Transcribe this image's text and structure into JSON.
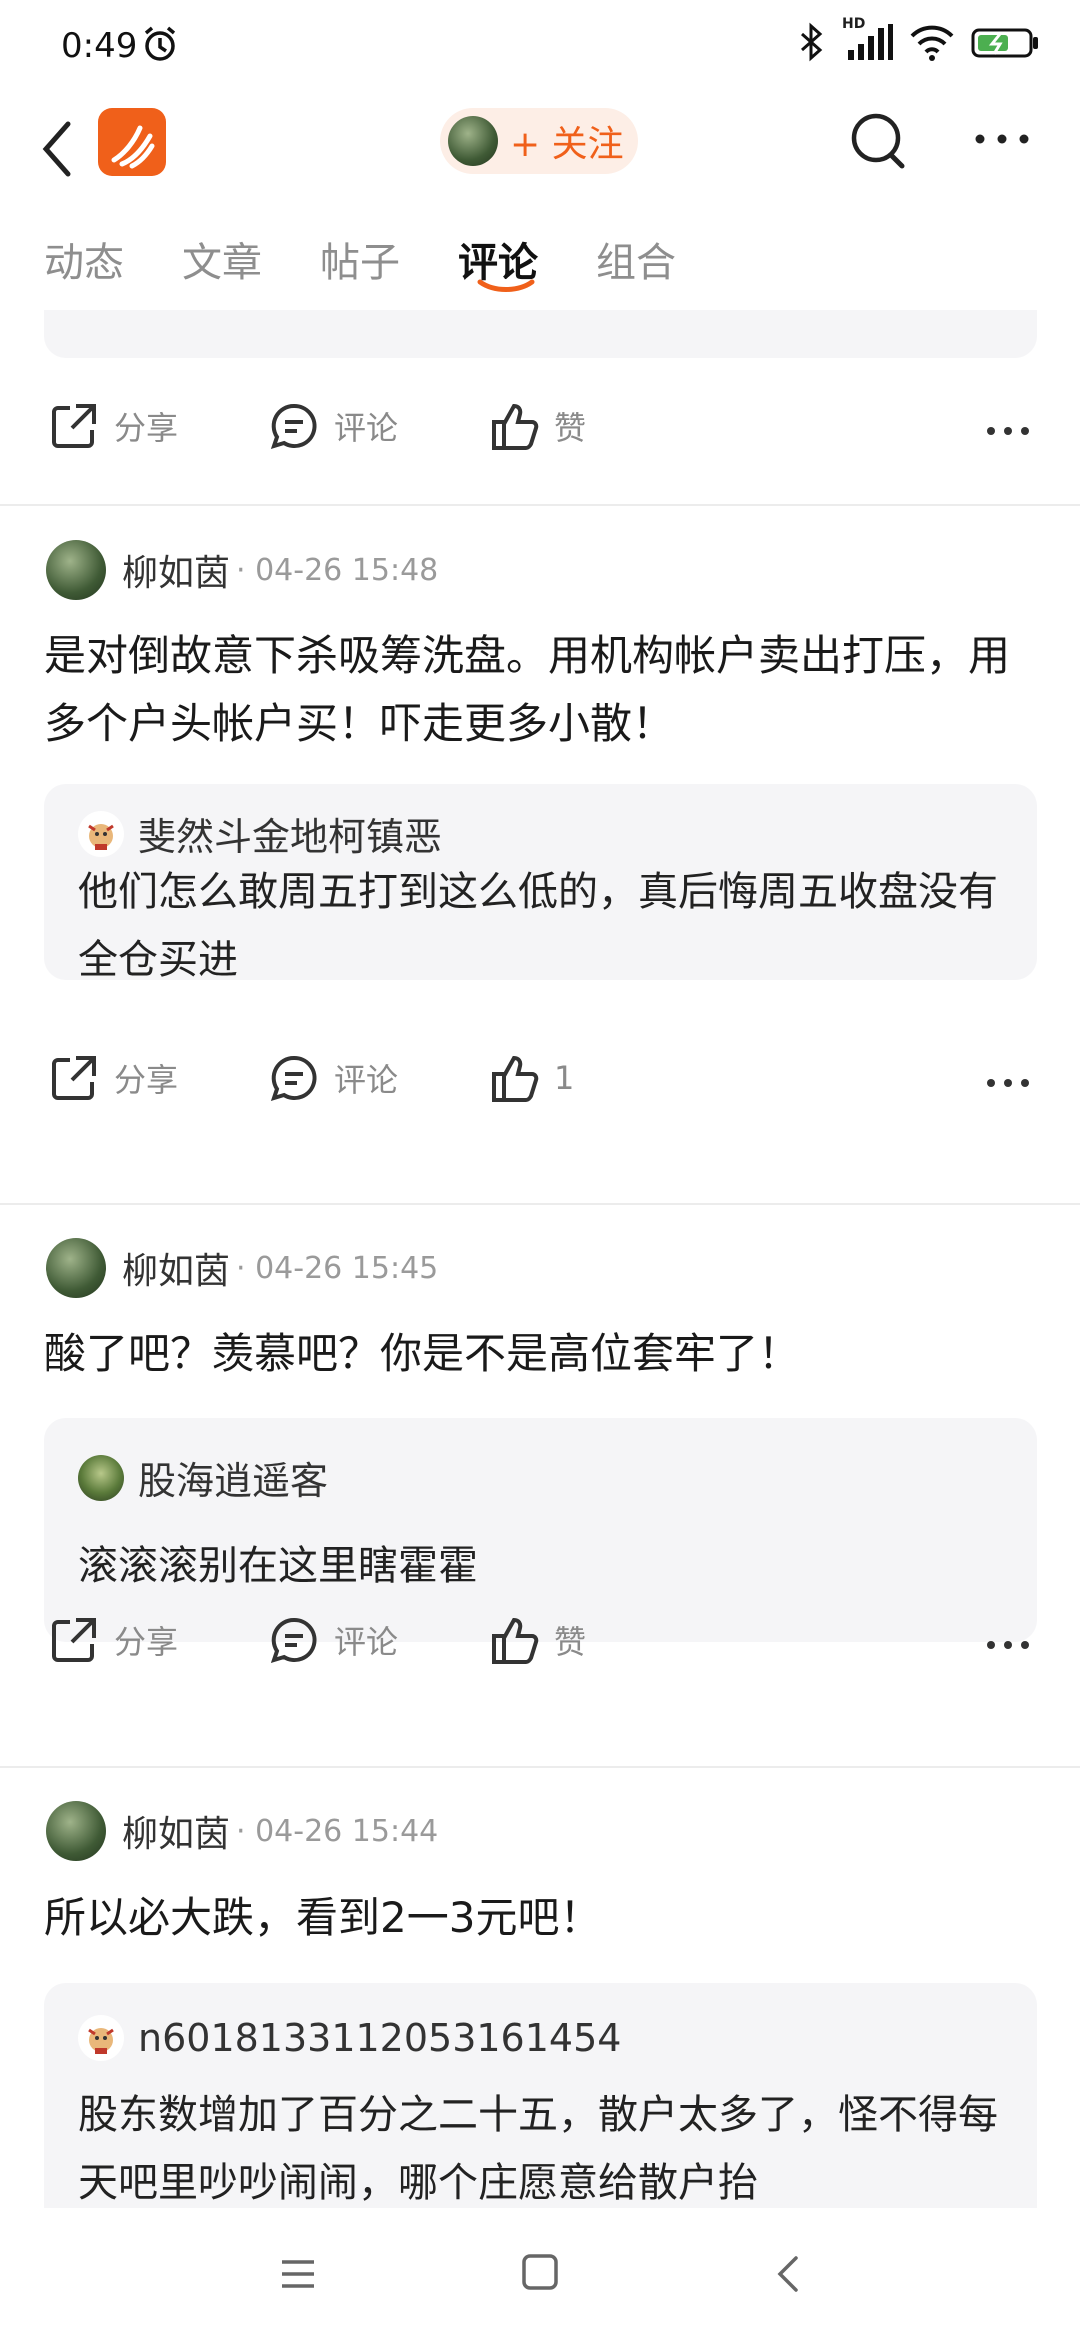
{
  "status_bar": {
    "time": "0:49",
    "network_label": "HD"
  },
  "header": {
    "follow_label": "+ 关注"
  },
  "tabs": [
    {
      "label": "动态"
    },
    {
      "label": "文章"
    },
    {
      "label": "帖子"
    },
    {
      "label": "评论",
      "active": true
    },
    {
      "label": "组合"
    }
  ],
  "posts": [
    {
      "actions": {
        "share": "分享",
        "comment": "评论",
        "like": "赞"
      }
    },
    {
      "author": "柳如茵",
      "time": "· 04-26 15:48",
      "text": "是对倒故意下杀吸筹洗盘。用机构帐户卖出打压，用多个户头帐户买！吓走更多小散！",
      "quote": {
        "author": "斐然斗金地柯镇恶",
        "text": "他们怎么敢周五打到这么低的，真后悔周五收盘没有全仓买进"
      },
      "actions": {
        "share": "分享",
        "comment": "评论",
        "like": "1"
      }
    },
    {
      "author": "柳如茵",
      "time": "· 04-26 15:45",
      "text": "酸了吧？羡慕吧？你是不是高位套牢了！",
      "quote": {
        "author": "股海逍遥客",
        "text": "滚滚滚别在这里瞎霍霍"
      },
      "actions": {
        "share": "分享",
        "comment": "评论",
        "like": "赞"
      }
    },
    {
      "author": "柳如茵",
      "time": "· 04-26 15:44",
      "text": "所以必大跌，看到2一3元吧！",
      "quote": {
        "author": "n6018133112053161454",
        "text": "股东数增加了百分之二十五，散户太多了，怪不得每天吧里吵吵闹闹，哪个庄愿意给散户抬"
      }
    }
  ],
  "colors": {
    "accent": "#f0601a",
    "follow_bg": "#fdeee6",
    "quote_bg": "#f5f5f7"
  }
}
